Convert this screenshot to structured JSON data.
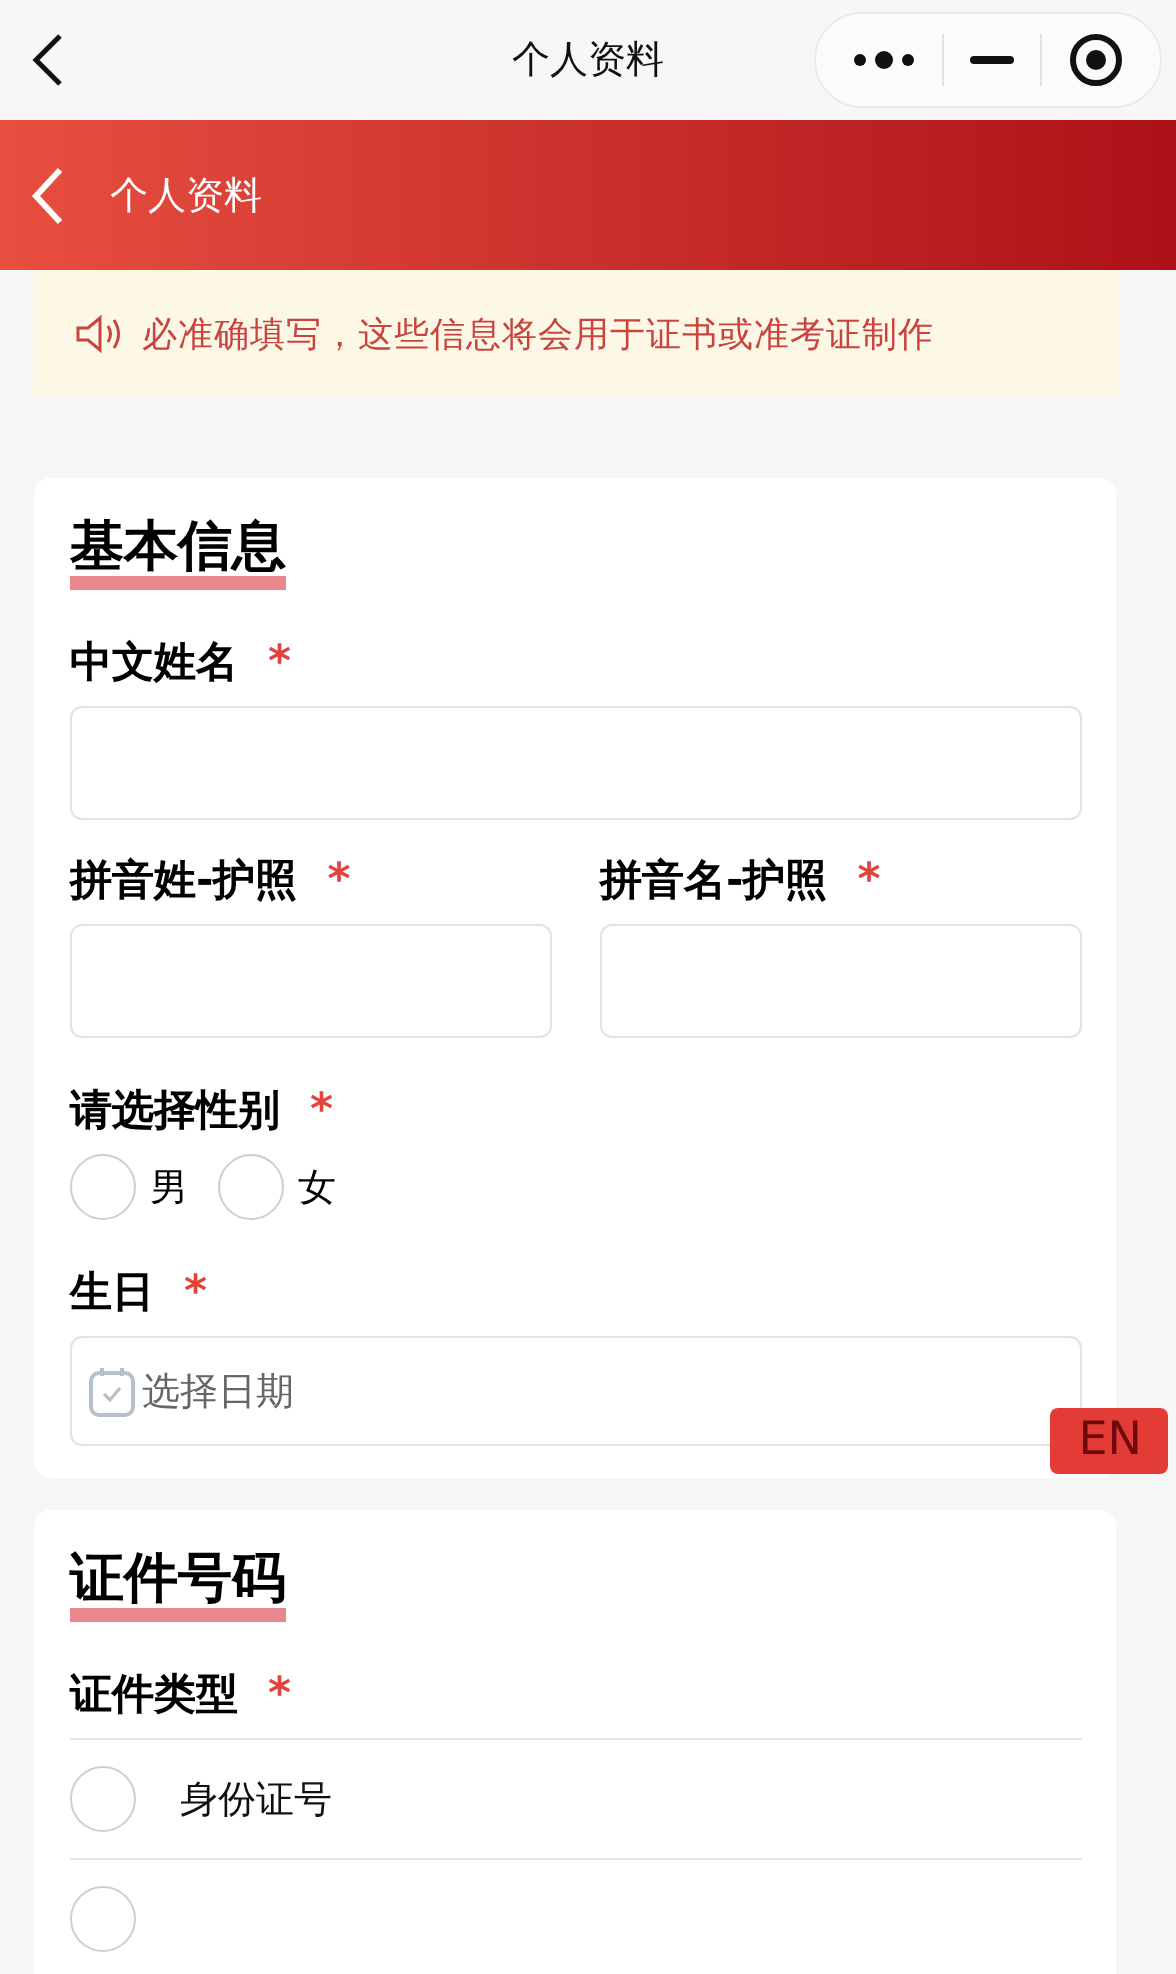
{
  "top_bar": {
    "title": "个人资料"
  },
  "header": {
    "title": "个人资料"
  },
  "notice": {
    "text": "必准确填写，这些信息将会用于证书或准考证制作"
  },
  "sections": [
    {
      "title": "基本信息",
      "fields": [
        {
          "kind": "text",
          "label": "中文姓名",
          "required_mark": "*"
        },
        {
          "kind": "pair",
          "items": [
            {
              "label": "拼音姓-护照",
              "required_mark": "*"
            },
            {
              "label": "拼音名-护照",
              "required_mark": "*"
            }
          ]
        },
        {
          "kind": "radio",
          "label": "请选择性别",
          "required_mark": "*",
          "options": [
            {
              "label": "男",
              "selected": false
            },
            {
              "label": "女",
              "selected": false
            }
          ]
        },
        {
          "kind": "date",
          "label": "生日",
          "required_mark": "*",
          "placeholder": "选择日期"
        }
      ]
    },
    {
      "title": "证件号码",
      "fields": [
        {
          "kind": "list",
          "label": "证件类型",
          "required_mark": "*",
          "options": [
            {
              "label": "身份证号",
              "selected": false
            },
            {
              "selected": false
            }
          ]
        }
      ]
    }
  ],
  "language_badge": {
    "text": "EN"
  }
}
